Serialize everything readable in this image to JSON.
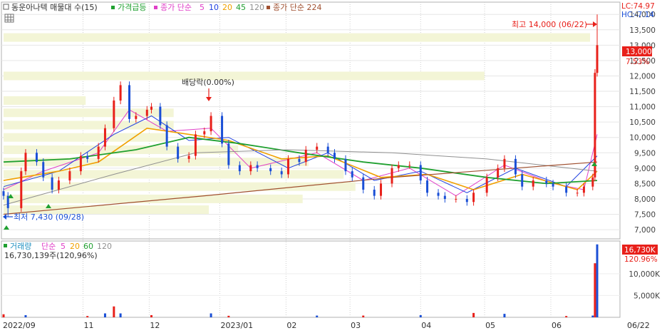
{
  "legend_top": {
    "stock_name": "동운아나텍 매물대 수(15)",
    "price_rise": "가격급등",
    "ma_label": "종가 단순",
    "ma_periods": [
      "5",
      "10",
      "20",
      "45",
      "120"
    ],
    "ma_long_label": "종가 단순 224"
  },
  "legend_bottom": {
    "volume_label": "거래량",
    "ma_label": "단순",
    "ma_periods": [
      "5",
      "20",
      "60",
      "120"
    ],
    "volume_value": "16,730,139주(120,96%)"
  },
  "right_panel": {
    "lc": "LC:74.97",
    "hc": "HC:-7.14",
    "price_badge": "13,000",
    "price_pct": "7.53%",
    "volume_badge": "16,730K",
    "volume_pct": "120.96%"
  },
  "annotations": {
    "high": "최고 14,000 (06/22)",
    "low": "최저 7,430 (09/28)",
    "dividend": "배당락(0.00%)"
  },
  "x_axis": {
    "labels": [
      "2022/09",
      "11",
      "12",
      "2023/01",
      "02",
      "03",
      "04",
      "05",
      "06"
    ],
    "current_date": "06/22"
  },
  "colors": {
    "up": "#e8201a",
    "down": "#1a4fd6",
    "ma5": "#e040c8",
    "ma10": "#2040e0",
    "ma20": "#f0a000",
    "ma45": "#20a030",
    "ma120": "#909090",
    "ma224": "#a05030",
    "volume_profile": "#f3f5d6"
  },
  "chart_data": [
    {
      "type": "candlestick",
      "title": "동운아나텍 매물대 수(15)",
      "ylim": [
        6700,
        14400
      ],
      "y_ticks": [
        7000,
        7500,
        8000,
        8500,
        9000,
        9500,
        10000,
        10500,
        11000,
        11500,
        12000,
        12500,
        13000,
        13500,
        14000
      ],
      "y_tick_labels": [
        "7,000",
        "7,500",
        "8,000",
        "8,500",
        "9,000",
        "9,500",
        "10,000",
        "10,500",
        "11,000",
        "11,500",
        "12,000",
        "12,500",
        "13,000",
        "13,500",
        "14,000"
      ],
      "x_range": [
        "2022/09/26",
        "2023/06/22"
      ],
      "close_series": [
        [
          "2022/09/26",
          8100
        ],
        [
          "2022/09/28",
          7700
        ],
        [
          "2022/10/04",
          8900
        ],
        [
          "2022/10/06",
          9500
        ],
        [
          "2022/10/11",
          9200
        ],
        [
          "2022/10/14",
          8700
        ],
        [
          "2022/10/18",
          8300
        ],
        [
          "2022/10/21",
          8600
        ],
        [
          "2022/10/26",
          8900
        ],
        [
          "2022/10/31",
          9400
        ],
        [
          "2022/11/03",
          9300
        ],
        [
          "2022/11/08",
          9700
        ],
        [
          "2022/11/11",
          10300
        ],
        [
          "2022/11/15",
          11200
        ],
        [
          "2022/11/18",
          11700
        ],
        [
          "2022/11/22",
          10600
        ],
        [
          "2022/11/25",
          10700
        ],
        [
          "2022/11/30",
          10900
        ],
        [
          "2022/12/02",
          11000
        ],
        [
          "2022/12/06",
          10400
        ],
        [
          "2022/12/09",
          9700
        ],
        [
          "2022/12/14",
          9300
        ],
        [
          "2022/12/19",
          9400
        ],
        [
          "2022/12/22",
          10100
        ],
        [
          "2022/12/26",
          10200
        ],
        [
          "2022/12/29",
          10700
        ],
        [
          "2023/01/03",
          9800
        ],
        [
          "2023/01/06",
          9100
        ],
        [
          "2023/01/11",
          8900
        ],
        [
          "2023/01/16",
          9100
        ],
        [
          "2023/01/19",
          9000
        ],
        [
          "2023/01/25",
          8900
        ],
        [
          "2023/01/30",
          8800
        ],
        [
          "2023/02/02",
          9300
        ],
        [
          "2023/02/07",
          9200
        ],
        [
          "2023/02/10",
          9600
        ],
        [
          "2023/02/15",
          9700
        ],
        [
          "2023/02/20",
          9500
        ],
        [
          "2023/02/23",
          9300
        ],
        [
          "2023/02/28",
          8900
        ],
        [
          "2023/03/03",
          8700
        ],
        [
          "2023/03/08",
          8300
        ],
        [
          "2023/03/13",
          8100
        ],
        [
          "2023/03/16",
          8500
        ],
        [
          "2023/03/21",
          9000
        ],
        [
          "2023/03/24",
          9100
        ],
        [
          "2023/03/29",
          9100
        ],
        [
          "2023/04/03",
          8600
        ],
        [
          "2023/04/06",
          8200
        ],
        [
          "2023/04/11",
          8100
        ],
        [
          "2023/04/14",
          8000
        ],
        [
          "2023/04/19",
          8000
        ],
        [
          "2023/04/24",
          7900
        ],
        [
          "2023/04/27",
          8200
        ],
        [
          "2023/05/03",
          8700
        ],
        [
          "2023/05/08",
          9000
        ],
        [
          "2023/05/11",
          9300
        ],
        [
          "2023/05/16",
          8800
        ],
        [
          "2023/05/19",
          8400
        ],
        [
          "2023/05/24",
          8600
        ],
        [
          "2023/05/30",
          8500
        ],
        [
          "2023/06/02",
          8400
        ],
        [
          "2023/06/08",
          8200
        ],
        [
          "2023/06/13",
          8200
        ],
        [
          "2023/06/16",
          8400
        ],
        [
          "2023/06/20",
          8700
        ],
        [
          "2023/06/21",
          12100
        ],
        [
          "2023/06/22",
          13000
        ]
      ],
      "high": {
        "date": "2023/06/22",
        "value": 14000
      },
      "low": {
        "date": "2022/09/28",
        "value": 7430
      },
      "series": [
        {
          "name": "5",
          "values": [
            [
              "2022/09/26",
              8300
            ],
            [
              "2022/10/14",
              8900
            ],
            [
              "2022/11/08",
              9500
            ],
            [
              "2022/11/22",
              10900
            ],
            [
              "2022/12/09",
              10200
            ],
            [
              "2022/12/29",
              10300
            ],
            [
              "2023/01/16",
              9000
            ],
            [
              "2023/02/15",
              9500
            ],
            [
              "2023/03/08",
              8600
            ],
            [
              "2023/03/29",
              9000
            ],
            [
              "2023/04/19",
              8100
            ],
            [
              "2023/05/11",
              9100
            ],
            [
              "2023/06/02",
              8500
            ],
            [
              "2023/06/16",
              8300
            ],
            [
              "2023/06/22",
              10100
            ]
          ]
        },
        {
          "name": "10",
          "values": [
            [
              "2022/09/26",
              8400
            ],
            [
              "2022/10/21",
              8900
            ],
            [
              "2022/11/15",
              10100
            ],
            [
              "2022/12/02",
              10700
            ],
            [
              "2022/12/19",
              9900
            ],
            [
              "2023/01/06",
              10000
            ],
            [
              "2023/02/02",
              9000
            ],
            [
              "2023/02/20",
              9500
            ],
            [
              "2023/03/13",
              8600
            ],
            [
              "2023/04/03",
              8900
            ],
            [
              "2023/04/24",
              8200
            ],
            [
              "2023/05/16",
              9000
            ],
            [
              "2023/06/08",
              8400
            ],
            [
              "2023/06/22",
              9400
            ]
          ]
        },
        {
          "name": "20",
          "values": [
            [
              "2022/09/26",
              8600
            ],
            [
              "2022/10/21",
              8900
            ],
            [
              "2022/11/08",
              9200
            ],
            [
              "2022/11/30",
              10300
            ],
            [
              "2022/12/19",
              10100
            ],
            [
              "2023/01/06",
              9900
            ],
            [
              "2023/01/30",
              9300
            ],
            [
              "2023/02/20",
              9400
            ],
            [
              "2023/03/16",
              8700
            ],
            [
              "2023/04/06",
              8800
            ],
            [
              "2023/04/27",
              8300
            ],
            [
              "2023/05/19",
              8800
            ],
            [
              "2023/06/13",
              8300
            ],
            [
              "2023/06/22",
              8900
            ]
          ]
        },
        {
          "name": "45",
          "values": [
            [
              "2022/09/26",
              9200
            ],
            [
              "2022/10/26",
              9300
            ],
            [
              "2022/11/25",
              9600
            ],
            [
              "2022/12/19",
              10000
            ],
            [
              "2023/01/11",
              9800
            ],
            [
              "2023/02/07",
              9500
            ],
            [
              "2023/03/08",
              9200
            ],
            [
              "2023/04/03",
              9000
            ],
            [
              "2023/05/03",
              8700
            ],
            [
              "2023/05/30",
              8500
            ],
            [
              "2023/06/22",
              8600
            ]
          ]
        },
        {
          "name": "120",
          "values": [
            [
              "2022/09/26",
              7800
            ],
            [
              "2022/11/15",
              8800
            ],
            [
              "2022/12/22",
              9500
            ],
            [
              "2023/02/02",
              9600
            ],
            [
              "2023/03/21",
              9500
            ],
            [
              "2023/05/03",
              9300
            ],
            [
              "2023/06/22",
              8900
            ]
          ]
        },
        {
          "name": "224",
          "values": [
            [
              "2022/09/26",
              7500
            ],
            [
              "2022/12/26",
              8100
            ],
            [
              "2023/03/21",
              8700
            ],
            [
              "2023/06/22",
              9200
            ]
          ]
        }
      ],
      "volume_profile": [
        {
          "price": 13250,
          "volume": 100
        },
        {
          "price": 12000,
          "volume": 82
        },
        {
          "price": 11200,
          "volume": 14
        },
        {
          "price": 10800,
          "volume": 29
        },
        {
          "price": 10400,
          "volume": 29
        },
        {
          "price": 10000,
          "volume": 28
        },
        {
          "price": 9600,
          "volume": 40
        },
        {
          "price": 9200,
          "volume": 52
        },
        {
          "price": 8800,
          "volume": 58
        },
        {
          "price": 8400,
          "volume": 60
        },
        {
          "price": 8000,
          "volume": 51
        },
        {
          "price": 7650,
          "volume": 35
        }
      ]
    },
    {
      "type": "bar",
      "title": "거래량",
      "unit": "K",
      "ylim": [
        0,
        17500
      ],
      "y_ticks": [
        5000,
        10000
      ],
      "y_tick_labels": [
        "5,000K",
        "10,000K"
      ],
      "values": [
        [
          "2022/09/26",
          700
        ],
        [
          "2022/10/06",
          500
        ],
        [
          "2022/11/03",
          300
        ],
        [
          "2022/11/11",
          900
        ],
        [
          "2022/11/15",
          2500
        ],
        [
          "2022/11/18",
          900
        ],
        [
          "2022/12/02",
          500
        ],
        [
          "2022/12/29",
          900
        ],
        [
          "2023/01/06",
          350
        ],
        [
          "2023/02/15",
          400
        ],
        [
          "2023/03/08",
          400
        ],
        [
          "2023/04/03",
          500
        ],
        [
          "2023/04/27",
          1000
        ],
        [
          "2023/05/11",
          800
        ],
        [
          "2023/06/08",
          300
        ],
        [
          "2023/06/20",
          400
        ],
        [
          "2023/06/21",
          12400
        ],
        [
          "2023/06/22",
          16730
        ]
      ],
      "last_value": 16730,
      "last_value_pct": "120.96%"
    }
  ]
}
